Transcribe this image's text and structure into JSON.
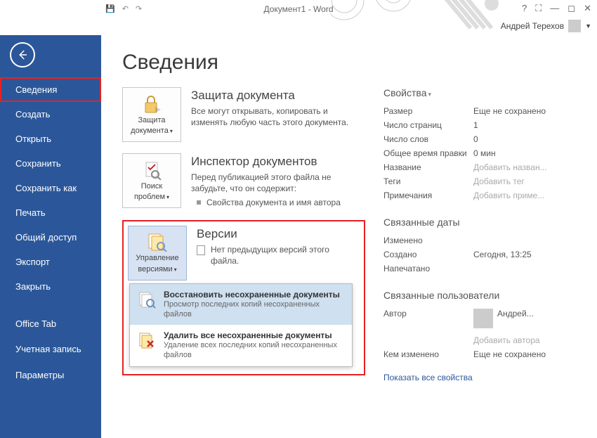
{
  "window": {
    "title": "Документ1 - Word",
    "user_name": "Андрей Терехов"
  },
  "sidebar": {
    "items": [
      {
        "label": "Сведения",
        "selected": true
      },
      {
        "label": "Создать"
      },
      {
        "label": "Открыть"
      },
      {
        "label": "Сохранить"
      },
      {
        "label": "Сохранить как"
      },
      {
        "label": "Печать"
      },
      {
        "label": "Общий доступ"
      },
      {
        "label": "Экспорт"
      },
      {
        "label": "Закрыть"
      }
    ],
    "bottom_items": [
      {
        "label": "Office Tab"
      },
      {
        "label": "Учетная запись"
      },
      {
        "label": "Параметры"
      }
    ]
  },
  "page": {
    "title": "Сведения"
  },
  "protect": {
    "btn_line1": "Защита",
    "btn_line2": "документа",
    "head": "Защита документа",
    "text": "Все могут открывать, копировать и изменять любую часть этого документа."
  },
  "inspect": {
    "btn_line1": "Поиск",
    "btn_line2": "проблем",
    "head": "Инспектор документов",
    "text": "Перед публикацией этого файла не забудьте, что он содержит:",
    "bullet": "Свойства документа и имя автора"
  },
  "versions": {
    "btn_line1": "Управление",
    "btn_line2": "версиями",
    "head": "Версии",
    "text": "Нет предыдущих версий этого файла.",
    "menu": {
      "restore_title": "Восстановить несохраненные документы",
      "restore_sub": "Просмотр последних копий несохраненных файлов",
      "delete_title": "Удалить все несохраненные документы",
      "delete_sub": "Удаление всех последних копий несохраненных файлов"
    }
  },
  "props": {
    "head": "Свойства",
    "rows": {
      "size_l": "Размер",
      "size_v": "Еще не сохранено",
      "pages_l": "Число страниц",
      "pages_v": "1",
      "words_l": "Число слов",
      "words_v": "0",
      "edit_l": "Общее время правки",
      "edit_v": "0 мин",
      "title_l": "Название",
      "title_v": "Добавить назван...",
      "tags_l": "Теги",
      "tags_v": "Добавить тег",
      "notes_l": "Примечания",
      "notes_v": "Добавить приме..."
    },
    "dates_head": "Связанные даты",
    "dates": {
      "mod_l": "Изменено",
      "mod_v": "",
      "crt_l": "Создано",
      "crt_v": "Сегодня, 13:25",
      "prn_l": "Напечатано",
      "prn_v": ""
    },
    "people_head": "Связанные пользователи",
    "author_l": "Автор",
    "author_v": "Андрей...",
    "add_author": "Добавить автора",
    "modby_l": "Кем изменено",
    "modby_v": "Еще не сохранено",
    "show_all": "Показать все свойства"
  }
}
